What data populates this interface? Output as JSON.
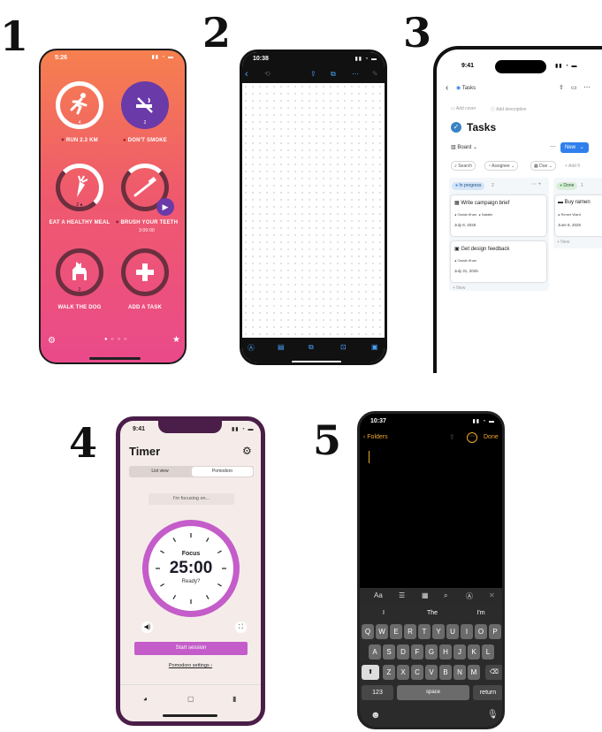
{
  "labels": {
    "n1": "1",
    "n2": "2",
    "n3": "3",
    "n4": "4",
    "n5": "5"
  },
  "phone1": {
    "time": "5:26",
    "habits": [
      {
        "label": "RUN 2.3 KM",
        "count": "4",
        "icon": "runner-icon"
      },
      {
        "label": "DON'T SMOKE",
        "count": "2",
        "icon": "no-smoking-icon"
      },
      {
        "label": "EAT A HEALTHY MEAL",
        "count": "2 ●",
        "icon": "carrot-icon"
      },
      {
        "label": "BRUSH YOUR TEETH",
        "sub": "3:00:00",
        "icon": "toothbrush-icon"
      },
      {
        "label": "WALK THE DOG",
        "count": "2",
        "icon": "dog-icon"
      },
      {
        "label": "ADD A TASK",
        "icon": "plus-icon"
      }
    ]
  },
  "phone2": {
    "time": "10:38"
  },
  "phone3": {
    "time": "9:41",
    "breadcrumb": "Tasks",
    "add_cover": "Add cover",
    "add_description": "Add description",
    "title": "Tasks",
    "view": "Board",
    "new_button": "New",
    "filters": {
      "search": "Search",
      "assignee": "Assignee",
      "due": "Due",
      "add": "+ Add fi"
    },
    "columns": [
      {
        "name": "In progress",
        "count": "2",
        "cards": [
          {
            "title": "Write campaign brief",
            "people": [
              "Owais Khan",
              "Natalie"
            ],
            "date": "July 8, 2025"
          },
          {
            "title": "Get design feedback",
            "people": [
              "Owais Khan"
            ],
            "date": "July 31, 2025"
          }
        ],
        "new": "+ New"
      },
      {
        "name": "Done",
        "count": "1",
        "cards": [
          {
            "title": "Buy ramen",
            "people": [
              "Renee Ward"
            ],
            "date": "June 8, 2025"
          }
        ],
        "new": "+ New"
      }
    ],
    "colors": {
      "accent": "#2f80ed",
      "in_progress": "#d3e5f7",
      "done": "#dbeddb"
    }
  },
  "phone4": {
    "time": "9:41",
    "title": "Timer",
    "tabs": [
      "List view",
      "Pomodoro"
    ],
    "focusing_placeholder": "I'm focusing on...",
    "focus_label": "Focus",
    "time_display": "25:00",
    "ready": "Ready?",
    "start_button": "Start session",
    "settings_link": "Pomodoro settings ›",
    "colors": {
      "accent": "#c45cc9",
      "frame": "#4a1e48"
    }
  },
  "phone5": {
    "time": "10:37",
    "back": "Folders",
    "done": "Done",
    "suggestions": [
      "I",
      "The",
      "I'm"
    ],
    "rows": [
      [
        "Q",
        "W",
        "E",
        "R",
        "T",
        "Y",
        "U",
        "I",
        "O",
        "P"
      ],
      [
        "A",
        "S",
        "D",
        "F",
        "G",
        "H",
        "J",
        "K",
        "L"
      ],
      [
        "Z",
        "X",
        "C",
        "V",
        "B",
        "N",
        "M"
      ]
    ],
    "num_key": "123",
    "space_key": "space",
    "return_key": "return",
    "format_label": "Aa",
    "colors": {
      "accent": "#f0a830"
    }
  }
}
